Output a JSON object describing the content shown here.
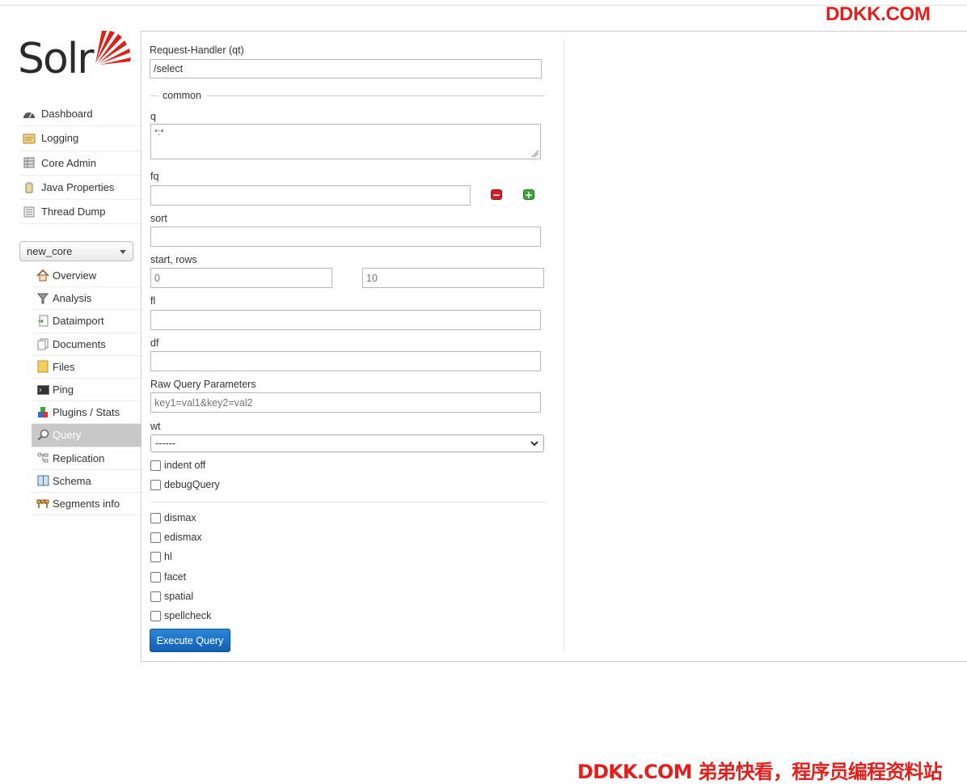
{
  "watermark": {
    "top": "DDKK.COM",
    "bottom": "DDKK.COM 弟弟快看，程序员编程资料站"
  },
  "logo": {
    "text": "Solr",
    "accent_color": "#d9241c"
  },
  "nav": {
    "items": [
      {
        "label": "Dashboard",
        "icon": "dashboard-icon"
      },
      {
        "label": "Logging",
        "icon": "logging-icon"
      },
      {
        "label": "Core Admin",
        "icon": "core-admin-icon"
      },
      {
        "label": "Java Properties",
        "icon": "java-properties-icon"
      },
      {
        "label": "Thread Dump",
        "icon": "thread-dump-icon"
      }
    ]
  },
  "core_selector": {
    "value": "new_core"
  },
  "core_nav": {
    "items": [
      {
        "label": "Overview",
        "icon": "home-icon"
      },
      {
        "label": "Analysis",
        "icon": "funnel-icon"
      },
      {
        "label": "Dataimport",
        "icon": "dataimport-icon"
      },
      {
        "label": "Documents",
        "icon": "documents-icon"
      },
      {
        "label": "Files",
        "icon": "folder-icon"
      },
      {
        "label": "Ping",
        "icon": "terminal-icon"
      },
      {
        "label": "Plugins / Stats",
        "icon": "blocks-icon"
      },
      {
        "label": "Query",
        "icon": "magnifier-icon",
        "active": true
      },
      {
        "label": "Replication",
        "icon": "replication-icon"
      },
      {
        "label": "Schema",
        "icon": "book-icon"
      },
      {
        "label": "Segments info",
        "icon": "barrier-icon"
      }
    ]
  },
  "query": {
    "request_handler": {
      "label": "Request-Handler (qt)",
      "value": "/select"
    },
    "common_legend": "common",
    "q": {
      "label": "q",
      "value": "*:*"
    },
    "fq": {
      "label": "fq",
      "value": ""
    },
    "sort": {
      "label": "sort",
      "value": ""
    },
    "start_rows": {
      "label": "start, rows",
      "start_placeholder": "0",
      "rows_placeholder": "10"
    },
    "fl": {
      "label": "fl",
      "value": ""
    },
    "df": {
      "label": "df",
      "value": ""
    },
    "raw": {
      "label": "Raw Query Parameters",
      "placeholder": "key1=val1&key2=val2"
    },
    "wt": {
      "label": "wt",
      "value": "------"
    },
    "indent": "indent off",
    "debug": "debugQuery",
    "options": [
      "dismax",
      "edismax",
      "hl",
      "facet",
      "spatial",
      "spellcheck"
    ],
    "execute": "Execute Query"
  },
  "colors": {
    "active_nav_bg": "#c8c8c8",
    "primary_button": "#1a6fc9",
    "remove": "#c9222a",
    "add": "#3fa33b"
  }
}
